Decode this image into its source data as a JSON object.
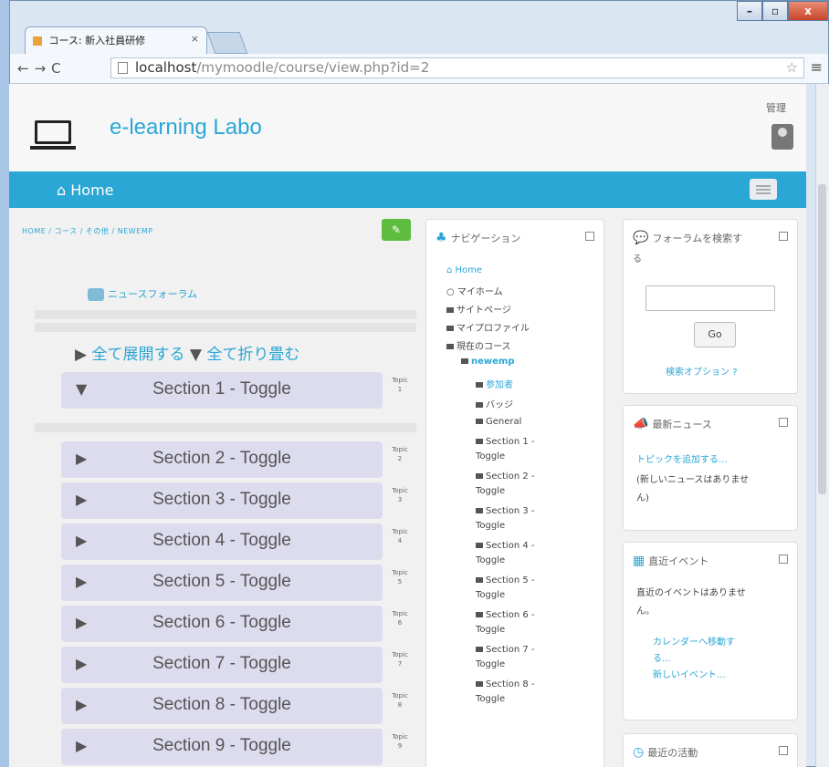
{
  "browser": {
    "tab_title": "コース: 新入社員研修",
    "tab_close": "×",
    "url_host": "localhost",
    "url_path": "/mymoodle/course/view.php?id=2",
    "min": "–",
    "max": "▫",
    "close": "x"
  },
  "site": {
    "title": "e-learning Labo",
    "user_name": "管理",
    "home_label": "Home"
  },
  "course": {
    "breadcrumb": "HOME / コース / その他 / NEWEMP",
    "news_forum": "ニュースフォーラム",
    "expand_all": "全て展開する",
    "collapse_all": "全て折り畳む",
    "sections": [
      {
        "label": "Section 1 - Toggle",
        "topic": "Topic",
        "num": "1"
      },
      {
        "label": "Section 2 - Toggle",
        "topic": "Topic",
        "num": "2"
      },
      {
        "label": "Section 3 - Toggle",
        "topic": "Topic",
        "num": "3"
      },
      {
        "label": "Section 4 - Toggle",
        "topic": "Topic",
        "num": "4"
      },
      {
        "label": "Section 5 - Toggle",
        "topic": "Topic",
        "num": "5"
      },
      {
        "label": "Section 6 - Toggle",
        "topic": "Topic",
        "num": "6"
      },
      {
        "label": "Section 7 - Toggle",
        "topic": "Topic",
        "num": "7"
      },
      {
        "label": "Section 8 - Toggle",
        "topic": "Topic",
        "num": "8"
      },
      {
        "label": "Section 9 - Toggle",
        "topic": "Topic",
        "num": "9"
      }
    ]
  },
  "navigation": {
    "title": "ナビゲーション",
    "items": [
      "Home",
      "マイホーム",
      "サイトページ",
      "マイプロファイル",
      "現在のコース",
      "newemp",
      "参加者",
      "バッジ",
      "General",
      "Section 1 -",
      "Toggle",
      "Section 2 -",
      "Toggle",
      "Section 3 -",
      "Toggle",
      "Section 4 -",
      "Toggle",
      "Section 5 -",
      "Toggle",
      "Section 6 -",
      "Toggle",
      "Section 7 -",
      "Toggle",
      "Section 8 -",
      "Toggle"
    ]
  },
  "forum_search": {
    "title": "フォーラムを検索す",
    "title2": "る",
    "go": "Go",
    "advanced": "検索オプション"
  },
  "latest_news": {
    "title": "最新ニュース",
    "add_topic": "トピックを追加する...",
    "empty1": "(新しいニュースはありませ",
    "empty2": "ん)"
  },
  "upcoming": {
    "title": "直近イベント",
    "empty1": "直近のイベントはありませ",
    "empty2": "ん。",
    "calendar1": "カレンダーへ移動す",
    "calendar2": "る...",
    "new_event": "新しいイベント..."
  },
  "recent": {
    "title": "最近の活動"
  }
}
